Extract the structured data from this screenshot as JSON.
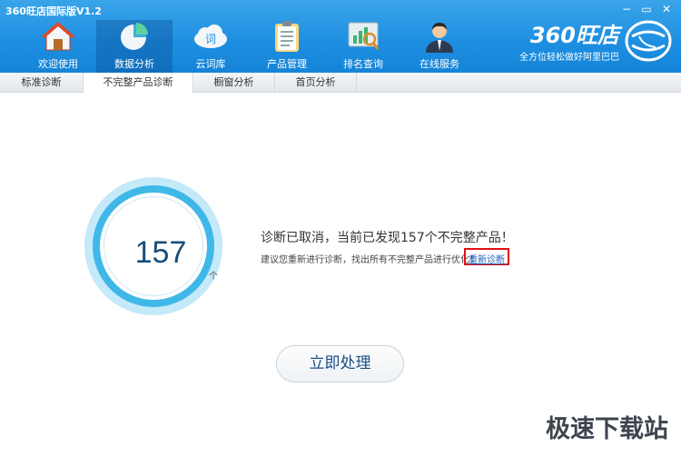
{
  "window": {
    "title": "360旺店国际版V1.2",
    "controls": [
      "−",
      "▭",
      "✕"
    ]
  },
  "nav": {
    "items": [
      {
        "label": "欢迎使用",
        "icon": "home-icon"
      },
      {
        "label": "数据分析",
        "icon": "pie-chart-icon",
        "active": true
      },
      {
        "label": "云词库",
        "icon": "cloud-icon"
      },
      {
        "label": "产品管理",
        "icon": "clipboard-icon"
      },
      {
        "label": "排名查询",
        "icon": "ranking-search-icon"
      },
      {
        "label": "在线服务",
        "icon": "support-agent-icon"
      }
    ],
    "cloud_glyph": "词"
  },
  "brand": {
    "name": "360旺店",
    "slogan": "全方位轻松做好阿里巴巴"
  },
  "tabs": [
    {
      "label": "标准诊断"
    },
    {
      "label": "不完整产品诊断",
      "active": true
    },
    {
      "label": "橱窗分析"
    },
    {
      "label": "首页分析"
    }
  ],
  "result": {
    "count": "157",
    "unit": "个",
    "message": "诊断已取消，当前已发现157个不完整产品！",
    "suggestion": "建议您重新进行诊断，找出所有不完整产品进行优化！",
    "rediagnose_link": "重新诊断",
    "action_button": "立即处理"
  },
  "watermark": "极速下载站",
  "colors": {
    "header_blue": "#1d8ee0",
    "ring_blue": "#3fb8e8",
    "highlight_red": "#e00f17"
  }
}
